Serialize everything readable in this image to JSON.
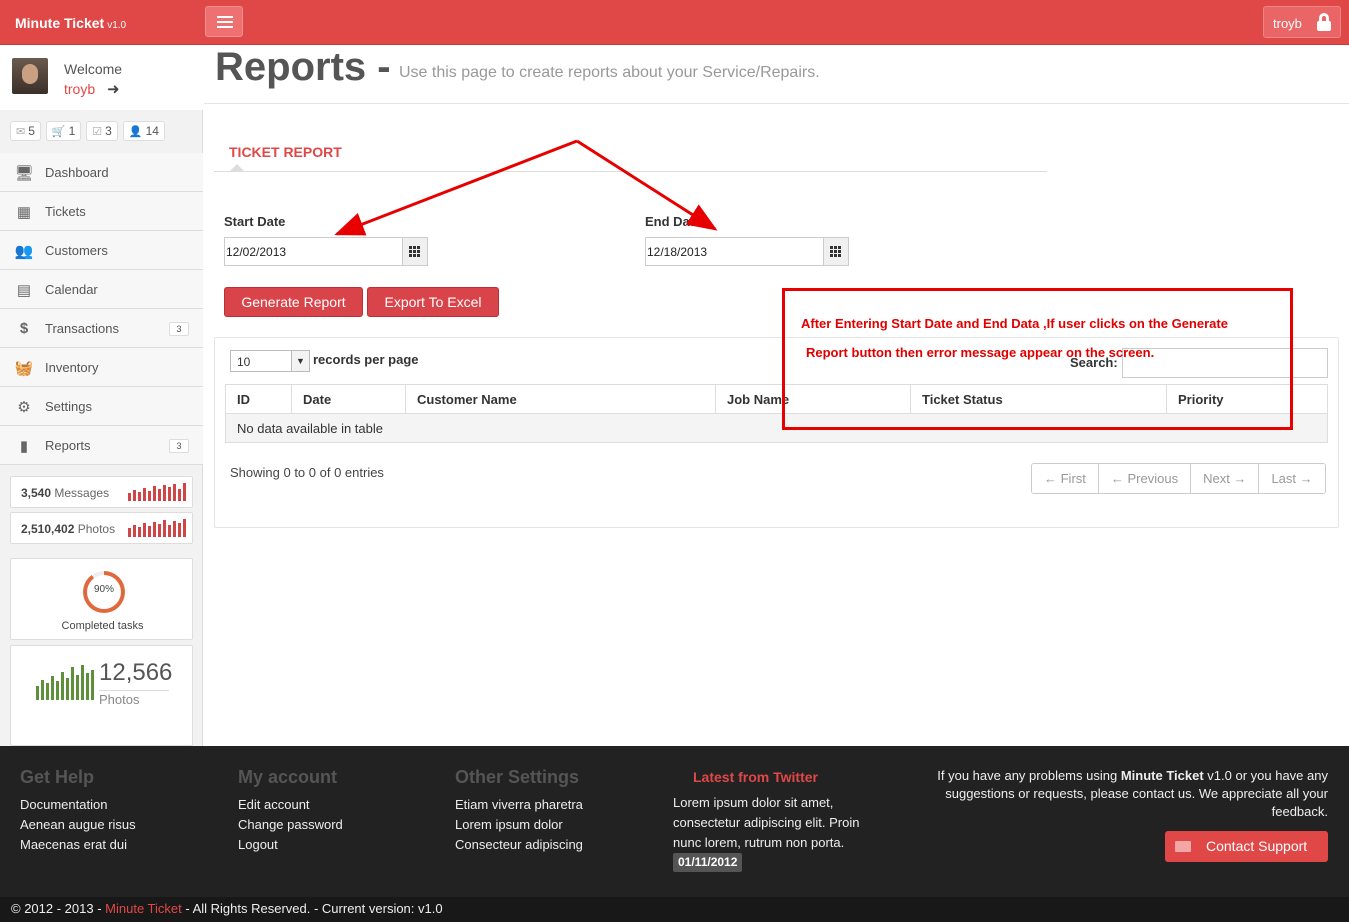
{
  "app": {
    "brand": "Minute Ticket",
    "version": "v1.0",
    "user": "troyb"
  },
  "sidebar": {
    "welcome": "Welcome",
    "username": "troyb",
    "badges": [
      {
        "icon": "mail-icon",
        "count": "5"
      },
      {
        "icon": "cart-icon",
        "count": "1"
      },
      {
        "icon": "check-icon",
        "count": "3"
      },
      {
        "icon": "user-plus-icon",
        "count": "14"
      }
    ],
    "nav": [
      {
        "label": "Dashboard",
        "icon": "monitor-icon",
        "count": ""
      },
      {
        "label": "Tickets",
        "icon": "table-icon",
        "count": ""
      },
      {
        "label": "Customers",
        "icon": "users-icon",
        "count": ""
      },
      {
        "label": "Calendar",
        "icon": "calendar-icon",
        "count": ""
      },
      {
        "label": "Transactions",
        "icon": "dollar-icon",
        "count": "3"
      },
      {
        "label": "Inventory",
        "icon": "basket-icon",
        "count": ""
      },
      {
        "label": "Settings",
        "icon": "gears-icon",
        "count": ""
      },
      {
        "label": "Reports",
        "icon": "file-icon",
        "count": "3"
      }
    ],
    "stats": [
      {
        "value": "3,540",
        "label": "Messages"
      },
      {
        "value": "2,510,402",
        "label": "Photos"
      }
    ],
    "tasks": {
      "percent": "90%",
      "label": "Completed tasks",
      "fraction": 0.9
    },
    "photos": {
      "value": "12,566",
      "label": "Photos"
    }
  },
  "page": {
    "title": "Reports -",
    "subtitle": "Use this page to create reports about your Service/Repairs.",
    "tab": "TICKET REPORT",
    "start_label": "Start Date",
    "start_value": "12/02/2013",
    "end_label": "End Date",
    "end_value": "12/18/2013",
    "generate": "Generate Report",
    "export": "Export To Excel"
  },
  "table": {
    "page_size": "10",
    "records_label": "records per page",
    "search_label": "Search:",
    "columns": [
      "ID",
      "Date",
      "Customer Name",
      "Job Name",
      "Ticket Status",
      "Priority"
    ],
    "empty": "No data available in table",
    "showing": "Showing 0 to 0 of 0 entries",
    "pager": [
      "← First",
      "← Previous",
      "Next →",
      "Last →"
    ]
  },
  "annotation": {
    "line1": "After Entering Start Date and End Data ,If user clicks on the Generate",
    "line2": "Report button then error message appear on the screen.",
    "color": "#e80000"
  },
  "footer": {
    "help": {
      "title": "Get Help",
      "links": [
        "Documentation",
        "Aenean augue risus",
        "Maecenas erat dui"
      ]
    },
    "account": {
      "title": "My account",
      "links": [
        "Edit account",
        "Change password",
        "Logout"
      ]
    },
    "other": {
      "title": "Other Settings",
      "links": [
        "Etiam viverra pharetra",
        "Lorem ipsum dolor",
        "Consecteur adipiscing"
      ]
    },
    "twitter": {
      "title": "Latest from Twitter",
      "text": "Lorem ipsum dolor sit amet, consectetur adipiscing elit. Proin nunc lorem, rutrum non porta.",
      "date": "01/11/2012"
    },
    "support_pre": "If you have any problems using",
    "support_brand": "Minute Ticket",
    "support_post": "v1.0 or you have any suggestions or requests, please contact us. We appreciate all your feedback.",
    "contact": "Contact Support"
  },
  "copyright": {
    "pre": "© 2012 - 2013 -",
    "brand": "Minute Ticket",
    "post": "- All Rights Reserved. - Current version: v1.0"
  },
  "colors": {
    "brand": "#e04848",
    "footer": "#222222"
  }
}
